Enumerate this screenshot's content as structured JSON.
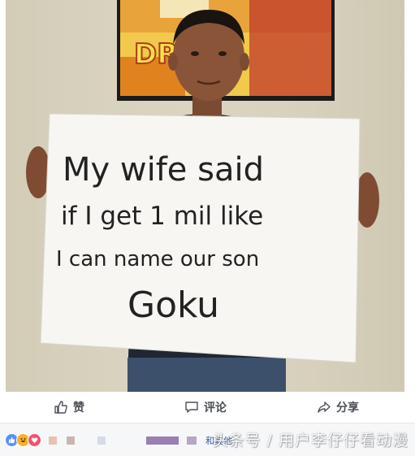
{
  "photo": {
    "sign_lines": [
      "My wife said",
      "if I get 1 mil like",
      "I can name our son",
      "Goku"
    ],
    "poster_text": "DRAG"
  },
  "actions": {
    "like_label": "赞",
    "comment_label": "评论",
    "share_label": "分享"
  },
  "reactions": {
    "others_text": "和其他",
    "watermark": "头条号 / 用户李仔仔看动漫"
  },
  "colors": {
    "action_text": "#4b4f56",
    "link_blue": "#365899",
    "like_blue": "#5890ff",
    "love_red": "#f25268",
    "haha_yellow": "#f7b125",
    "wall": "#d9d3bf",
    "sign": "#f7f6f2"
  }
}
